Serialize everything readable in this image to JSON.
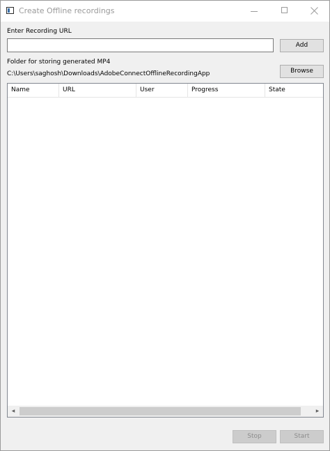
{
  "window": {
    "title": "Create Offline recordings"
  },
  "form": {
    "url_label": "Enter Recording URL",
    "url_value": "",
    "add_label": "Add",
    "folder_label": "Folder for storing generated MP4",
    "folder_path": "C:\\Users\\saghosh\\Downloads\\AdobeConnectOfflineRecordingApp",
    "browse_label": "Browse"
  },
  "table": {
    "columns": [
      "Name",
      "URL",
      "User",
      "Progress",
      "State"
    ],
    "rows": []
  },
  "footer": {
    "stop_label": "Stop",
    "start_label": "Start"
  },
  "scrollbar": {
    "left_icon": "◂",
    "right_icon": "▸"
  }
}
